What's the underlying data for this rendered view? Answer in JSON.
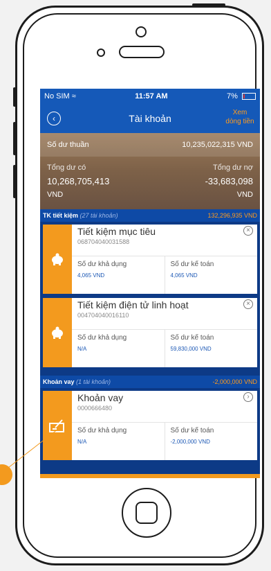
{
  "status_bar": {
    "carrier": "No SIM",
    "time": "11:57 AM",
    "battery": "7%"
  },
  "nav": {
    "title": "Tài khoản",
    "right_line1": "Xem",
    "right_line2": "dòng tiền"
  },
  "summary": {
    "net_label": "Số dư thuần",
    "net_value": "10,235,022,315 VND",
    "assets_label": "Tổng dư có",
    "assets_value": "10,268,705,413",
    "assets_unit": "VND",
    "debt_label": "Tổng dư nợ",
    "debt_value": "-33,683,098",
    "debt_unit": "VND"
  },
  "savings_section": {
    "title": "TK tiết kiệm",
    "subtitle": "(27 tài khoản)",
    "total": "132,296,935 VND"
  },
  "savings_accounts": [
    {
      "name": "Tiết kiệm mục tiêu",
      "number": "068704040031588",
      "available_label": "Số dư khả dụng",
      "available_value": "4,065 VND",
      "ledger_label": "Số dư kế toán",
      "ledger_value": "4,065 VND"
    },
    {
      "name": "Tiết kiệm điện tử linh hoạt",
      "number": "004704040016110",
      "available_label": "Số dư khả dụng",
      "available_value": "N/A",
      "ledger_label": "Số dư kế toán",
      "ledger_value": "59,830,000 VND"
    }
  ],
  "loan_section": {
    "title": "Khoản vay",
    "subtitle": "(1 tài khoản)",
    "total": "-2,000,000 VND"
  },
  "loan_accounts": [
    {
      "name": "Khoản vay",
      "number": "0000666480",
      "available_label": "Số dư khả dụng",
      "available_value": "N/A",
      "ledger_label": "Số dư kế toán",
      "ledger_value": "-2,000,000 VND"
    }
  ],
  "colors": {
    "accent_orange": "#f39a1e",
    "brand_blue": "#1559b8",
    "link_blue": "#1c58b5"
  },
  "icons": {
    "back": "back-arrow-icon",
    "wifi": "wifi-icon",
    "piggy": "piggy-bank-icon",
    "loan": "loan-document-icon",
    "close": "close-circle-icon",
    "chevron": "chevron-right-circle-icon"
  }
}
